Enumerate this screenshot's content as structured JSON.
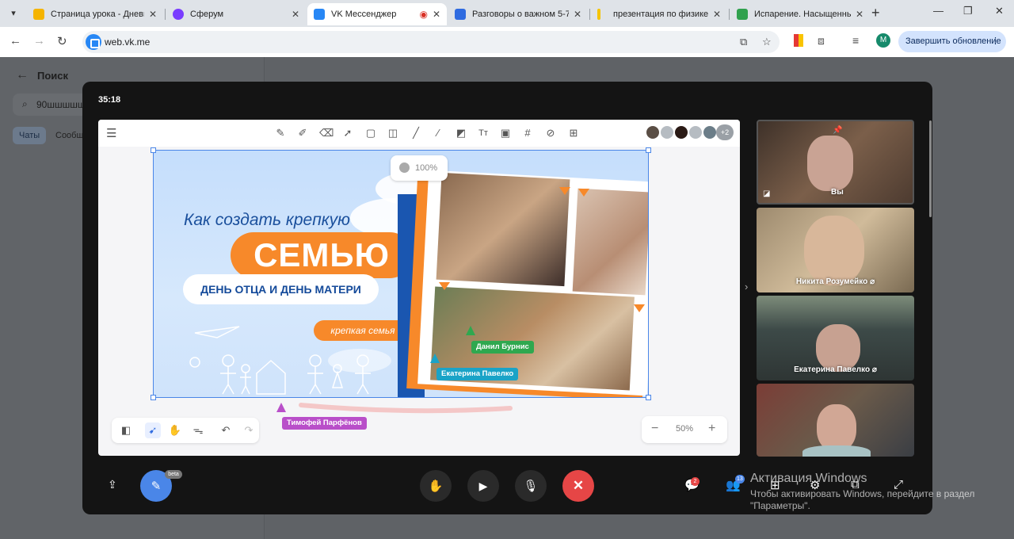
{
  "browser": {
    "tabs": [
      {
        "label": "Страница урока - Дневни",
        "color": "#f5b400"
      },
      {
        "label": "Сферум",
        "color": "#7a3cff"
      },
      {
        "label": "VK Мессенджер",
        "color": "#2787f5",
        "active": true
      },
      {
        "label": "Разговоры о важном 5-7",
        "color": "#2f6be0"
      },
      {
        "label": "презентация по физике &",
        "color": "#f5c400"
      },
      {
        "label": "Испарение. Насыщенный",
        "color": "#30a14e"
      }
    ],
    "url": "web.vk.me",
    "update_button": "Завершить обновление",
    "profile_initial": "M"
  },
  "vk": {
    "search_title": "Поиск",
    "search_value": "90шшшшш",
    "chips": [
      "Чаты",
      "Сообщ"
    ]
  },
  "call": {
    "timer": "35:18",
    "opacity": "100%",
    "zoom": "50%",
    "more_participants": "+2",
    "slide": {
      "title_line1": "Как создать крепкую",
      "title_line2": "СЕМЬЮ",
      "subtitle": "ДЕНЬ ОТЦА И ДЕНЬ МАТЕРИ",
      "tag": "крепкая семья"
    },
    "cursors": [
      {
        "name": "Данил Бурнис",
        "color": "#2fa84f"
      },
      {
        "name": "Екатерина Павелко",
        "color": "#1aa3c7"
      },
      {
        "name": "Тимофей Парфёнов",
        "color": "#b94fc9"
      }
    ],
    "tiles": [
      {
        "name": "Вы",
        "bg": "#5b4a3b"
      },
      {
        "name": "Никита Розумейко",
        "bg": "#b8a07c"
      },
      {
        "name": "Екатерина Павелко",
        "bg": "#4a5a55"
      },
      {
        "name": "",
        "bg": "#5c4a3f"
      }
    ],
    "board_beta": "beta",
    "chat_badge": "2",
    "participants_badge": "13"
  },
  "windows_activation": {
    "title": "Активация Windows",
    "line1": "Чтобы активировать Windows, перейдите в раздел",
    "line2": "\"Параметры\"."
  }
}
